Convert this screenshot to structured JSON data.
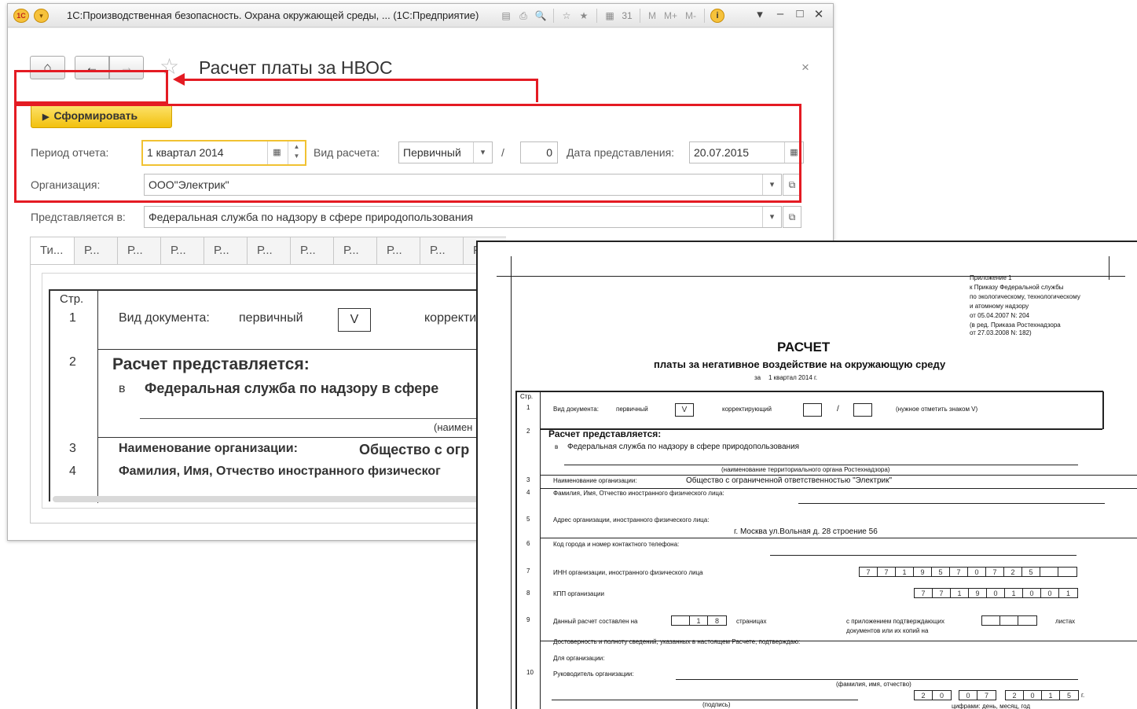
{
  "window": {
    "title": "1С:Производственная безопасность. Охрана окружающей среды, ... (1С:Предприятие)",
    "logo_text": "1С",
    "menu_glyph": "▾",
    "tools": [
      "▤",
      "⎙",
      "🔍",
      "☆",
      "★",
      "▦",
      "31"
    ],
    "memory_buttons": [
      "M",
      "M+",
      "M-"
    ],
    "info_glyph": "i",
    "controls": {
      "dropdown": "▾",
      "minimize": "–",
      "maximize": "□",
      "close": "✕"
    }
  },
  "form": {
    "home_glyph": "⌂",
    "back_glyph": "←",
    "forward_glyph": "→",
    "star_glyph": "☆",
    "title": "Расчет платы за НВОС",
    "close_glyph": "×",
    "generate_button": "Сформировать",
    "period_label": "Период отчета:",
    "period_value": "1 квартал 2014",
    "calc_type_label": "Вид расчета:",
    "calc_type_value": "Первичный",
    "slash": "/",
    "correction_number": "0",
    "date_label": "Дата представления:",
    "date_value": "20.07.2015",
    "org_label": "Организация:",
    "org_value": "ООО\"Электрик\"",
    "submitted_label": "Представляется в:",
    "submitted_value": "Федеральная служба по надзору в сфере природопользования",
    "tabs": [
      "Ти...",
      "Р...",
      "Р...",
      "Р...",
      "Р...",
      "Р...",
      "Р...",
      "Р...",
      "Р...",
      "Р...",
      "Р"
    ]
  },
  "preview": {
    "row_header": "Стр.",
    "rows": [
      {
        "num": "1",
        "text": "Вид документа:",
        "value": "первичный",
        "box": "V",
        "extra": "корректи"
      },
      {
        "num": "2",
        "heading": "Расчет представляется:",
        "prefix": "в",
        "text": "Федеральная служба по надзору в сфере",
        "note": "(наимен"
      },
      {
        "num": "3",
        "text": "Наименование организации:",
        "value": "Общество с огр"
      },
      {
        "num": "4",
        "text": "Фамилия, Имя, Отчество иностранного физическог"
      }
    ]
  },
  "report": {
    "appendix": [
      "Приложение 1",
      "к Приказу Федеральной службы",
      "по экологическому, технологическому",
      "и атомному надзору",
      "от 05.04.2007 N: 204",
      "(в ред. Приказа Ростехнадзора",
      "от 27.03.2008 N: 182)"
    ],
    "title": "РАСЧЕТ",
    "subtitle": "платы за негативное воздействие на окружающую среду",
    "period_prefix": "за",
    "period": "1 квартал 2014 г.",
    "row_header": "Стр.",
    "r1_label": "Вид документа:",
    "r1_primary": "первичный",
    "r1_box": "V",
    "r1_corr": "корректирующий",
    "r1_slash": "/",
    "r1_note": "(нужное отметить знаком V)",
    "r2_heading": "Расчет представляется:",
    "r2_prefix": "в",
    "r2_value": "Федеральная служба по надзору в сфере природопользования",
    "r2_note": "(наименование территориального органа Ростехнадзора)",
    "r3_label": "Наименование организации:",
    "r3_value": "Общество с ограниченной ответственностью \"Электрик\"",
    "r4_label": "Фамилия, Имя, Отчество иностранного физического лица:",
    "r5_label": "Адрес организации, иностранного физического лица:",
    "r5_value": "г. Москва ул.Вольная д. 28 строение 56",
    "r6_label": "Код города и номер контактного телефона:",
    "r7_label": "ИНН организации, иностранного физического лица",
    "inn": [
      "7",
      "7",
      "1",
      "9",
      "5",
      "7",
      "0",
      "7",
      "2",
      "5",
      "",
      ""
    ],
    "r8_label": "КПП организации",
    "kpp": [
      "7",
      "7",
      "1",
      "9",
      "0",
      "1",
      "0",
      "0",
      "1"
    ],
    "r9_label": "Данный расчет составлен на",
    "pages": [
      "",
      "1",
      "8"
    ],
    "r9_pages_word": "страницах",
    "r9_attach": "с приложением подтверждающих",
    "r9_attach2": "документов или их копий на",
    "r9_sheets": "листах",
    "attach_cells": [
      "",
      "",
      ""
    ],
    "confirm": "Достоверность и полноту сведений, указанных в настоящем Расчете, подтверждаю:",
    "for_org": "Для организации:",
    "r10_label": "Руководитель организации:",
    "fio_note": "(фамилия, имя, отчество)",
    "sign_note": "(подпись)",
    "date_note": "цифрами: день, месяц, год",
    "day": [
      "2",
      "0"
    ],
    "month": [
      "0",
      "7"
    ],
    "year": [
      "2",
      "0",
      "1",
      "5"
    ],
    "year_suffix": "г.",
    "row_numbers": [
      "1",
      "2",
      "3",
      "4",
      "5",
      "6",
      "7",
      "8",
      "9",
      "10"
    ]
  }
}
